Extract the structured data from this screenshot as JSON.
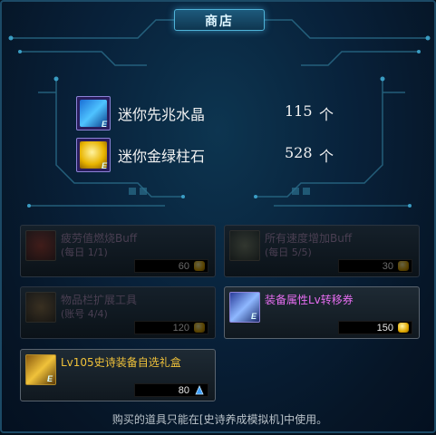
{
  "window": {
    "title": "商店"
  },
  "top_items": [
    {
      "name": "迷你先兆水晶",
      "count": "115",
      "unit": "个",
      "icon": "blue-crystal-icon"
    },
    {
      "name": "迷你金绿柱石",
      "count": "528",
      "unit": "个",
      "icon": "gold-gem-icon"
    }
  ],
  "shop_items": [
    {
      "name": "疲劳值燃烧Buff",
      "sub": "(每日 1/1)",
      "price": "60",
      "currency": "gold-coin-icon",
      "state": "disabled",
      "name_color": "#4a3f52"
    },
    {
      "name": "所有速度增加Buff",
      "sub": "(每日 5/5)",
      "price": "30",
      "currency": "gold-coin-icon",
      "state": "disabled",
      "name_color": "#4a3f52"
    },
    {
      "name": "物品栏扩展工具",
      "sub": "(账号 4/4)",
      "price": "120",
      "currency": "gold-coin-icon",
      "state": "disabled",
      "name_color": "#4a3f52"
    },
    {
      "name": "装备属性Lv转移券",
      "sub": "",
      "price": "150",
      "currency": "gold-coin-icon",
      "state": "active",
      "name_color": "#e66df0"
    },
    {
      "name": "Lv105史诗装备自选礼盒",
      "sub": "",
      "price": "80",
      "currency": "blue-crystal-icon",
      "state": "active",
      "name_color": "#f0c23a"
    }
  ],
  "footer": {
    "text": "购买的道具只能在[史诗养成模拟机]中使用。"
  }
}
